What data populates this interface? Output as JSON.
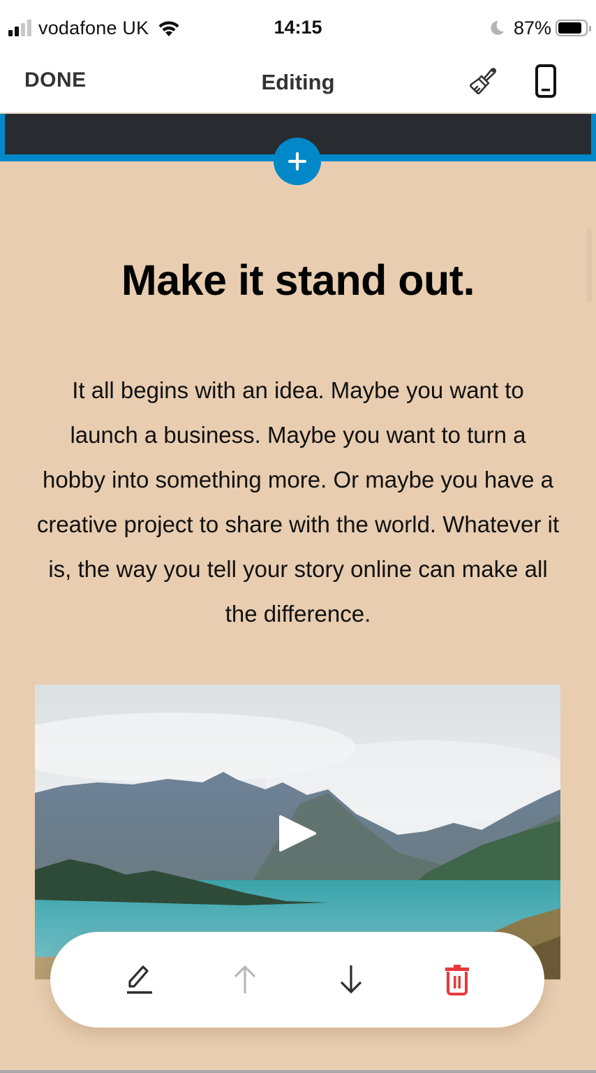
{
  "status_bar": {
    "carrier": "vodafone UK",
    "signal_bars_active": 2,
    "signal_bars_total": 4,
    "time": "14:15",
    "battery_percent": "87%",
    "battery_level": 0.87,
    "icons": [
      "signal-icon",
      "wifi-icon",
      "do-not-disturb-moon-icon",
      "battery-icon"
    ]
  },
  "nav": {
    "done_label": "DONE",
    "title": "Editing",
    "actions": [
      {
        "name": "design-brush",
        "icon": "paintbrush-icon"
      },
      {
        "name": "device-preview",
        "icon": "mobile-phone-icon"
      }
    ]
  },
  "add_section": {
    "icon": "plus-icon"
  },
  "section": {
    "headline": "Make it stand out.",
    "body": "It all begins with an idea. Maybe you want to launch a business. Maybe you want to turn a hobby into something more. Or maybe you have a creative project to share with the world. Whatever it is, the way you tell your story online can make all the difference.",
    "video": {
      "thumbnail": "mountain lake landscape",
      "icon": "play-icon"
    }
  },
  "block_toolbar": {
    "items": [
      {
        "name": "edit",
        "icon": "pencil-icon",
        "enabled": true
      },
      {
        "name": "move-up",
        "icon": "arrow-up-icon",
        "enabled": false
      },
      {
        "name": "move-down",
        "icon": "arrow-down-icon",
        "enabled": true
      },
      {
        "name": "delete",
        "icon": "trash-icon",
        "enabled": true
      }
    ]
  },
  "colors": {
    "accent": "#0088c9",
    "page_bg": "#e8cdb0",
    "header_block": "#282b2f",
    "delete": "#e8383d",
    "disabled": "#b8b8b8",
    "icon_dark": "#2e2e2e"
  }
}
